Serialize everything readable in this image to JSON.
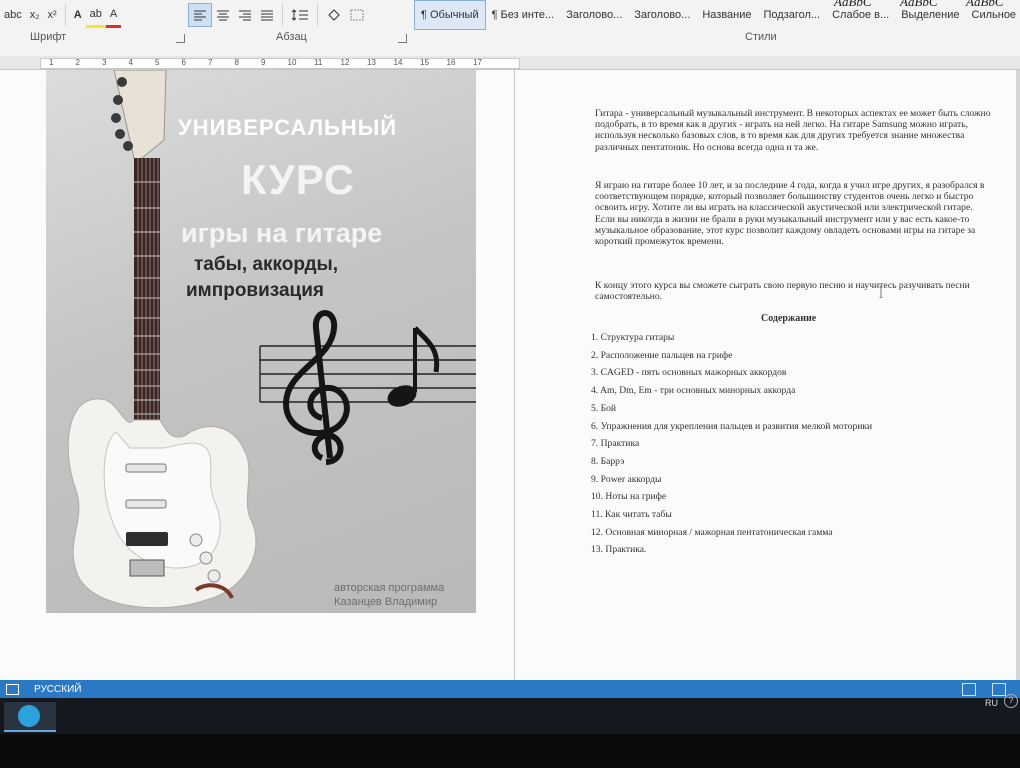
{
  "ribbon": {
    "font_group_label": "Шрифт",
    "paragraph_group_label": "Абзац",
    "styles_group_label": "Стили",
    "font_buttons": [
      "abc",
      "x₂",
      "x²",
      "A",
      "ab",
      "A"
    ],
    "styles": [
      {
        "label": "¶ Обычный",
        "selected": true
      },
      {
        "label": "¶ Без инте..."
      },
      {
        "label": "Заголово..."
      },
      {
        "label": "Заголово..."
      },
      {
        "label": "Название"
      },
      {
        "label": "Подзагол..."
      },
      {
        "label": "Слабое в..."
      },
      {
        "label": "Выделение"
      },
      {
        "label": "Сильное ..."
      }
    ],
    "style_previews": [
      "AaBbC",
      "AaBbC",
      "AaBbC",
      "AaBbC"
    ],
    "accent": "#2b78c5"
  },
  "ruler": {
    "marks": [
      "1",
      "2",
      "3",
      "4",
      "5",
      "6",
      "7",
      "8",
      "9",
      "10",
      "11",
      "12",
      "13",
      "14",
      "15",
      "16",
      "17"
    ]
  },
  "cover": {
    "line1": "УНИВЕРСАЛЬНЫЙ",
    "line2": "КУРС",
    "line3": "игры на гитаре",
    "line4": "табы, аккорды,",
    "line5": "импровизация",
    "author1": "авторская программа",
    "author2": "Казанцев Владимир"
  },
  "document": {
    "paragraphs": [
      "Гитара - универсальный музыкальный инструмент. В некоторых аспектах ее может быть сложно подобрать, в то время как в других - играть на ней легко. На гитаре Samsung можно играть, используя несколько базовых слов, в то время как для других требуется знание множества различных пентатоник. Но основа всегда одна и та же.",
      "Я играю на гитаре более 10 лет, и за последние 4 года, когда я учил игре других, я разобрался в соответствующем порядке, который позволяет большинству студентов очень легко и быстро освоить игру. Хотите ли вы играть на классической акустической или электрической гитаре. Если вы никогда в жизни не брали в руки музыкальный инструмент или у вас есть какое-то музыкальное образование, этот курс позволит каждому овладеть основами игры на гитаре за короткий промежуток времени.",
      "К концу этого курса вы сможете сыграть свою первую песню и научитесь разучивать песни самостоятельно."
    ],
    "toc_title": "Содержание",
    "toc": [
      "1. Структура гитары",
      "2. Расположение пальцев на грифе",
      "3. CAGED - пять основных мажорных аккордов",
      "4. Am, Dm, Em - три основных минорных аккорда",
      "5. Бой",
      "6. Упражнения для укрепления пальцев и развития мелкой моторики",
      "7. Практика",
      "8. Баррэ",
      "9. Power аккорды",
      "10. Ноты на грифе",
      "11. Как читать табы",
      "12. Основная минорная / мажорная пентатоническая гамма",
      "13. Практика."
    ]
  },
  "statusbar": {
    "language": "РУССКИЙ"
  },
  "taskbar": {
    "tray_lang": "RU",
    "help": "?"
  }
}
